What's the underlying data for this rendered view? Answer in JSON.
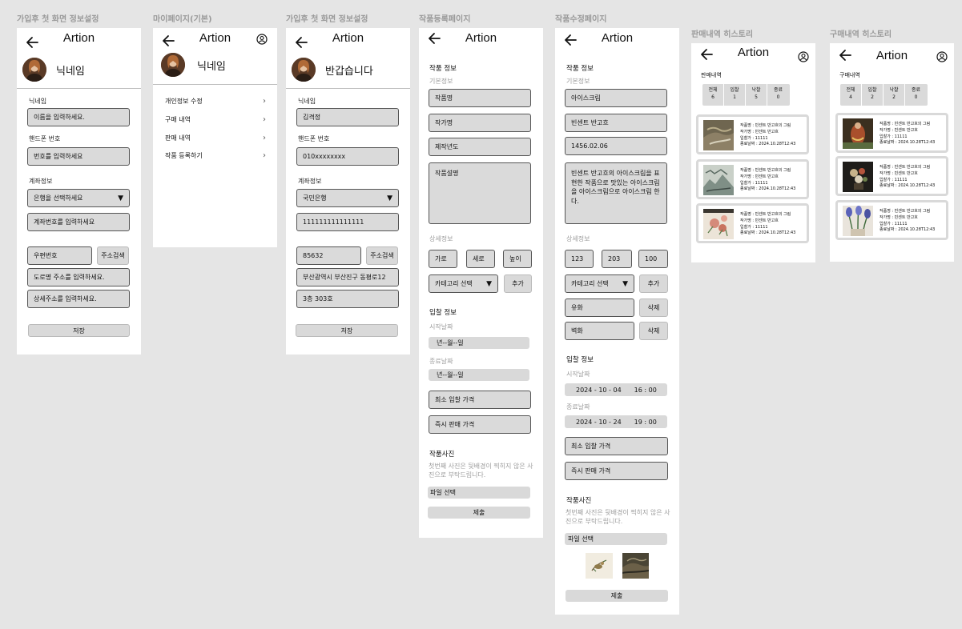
{
  "app_title": "Artion",
  "screens": {
    "signup1": {
      "caption": "가입후 첫 화면 정보설정",
      "nickname": "닉네임",
      "nick_label": "닉네임",
      "nick_placeholder": "이름을 입력하세요.",
      "phone_label": "핸드폰 번호",
      "phone_placeholder": "번호를 입력하세요",
      "account_label": "계좌정보",
      "bank_select": "은행을 선택하세요",
      "account_placeholder": "계좌번호를 입력하세요",
      "zip_placeholder": "우편번호",
      "zip_search": "주소검색",
      "road_placeholder": "도로명 주소를 입력하세요.",
      "detail_placeholder": "상세주소를 입력하세요.",
      "save": "저장"
    },
    "mypage": {
      "caption": "마이페이지(기본)",
      "nickname": "닉네임",
      "menu": [
        "개인정보 수정",
        "구매 내역",
        "판매 내역",
        "작품 등록하기"
      ]
    },
    "signup2": {
      "caption": "가입후 첫 화면 정보설정",
      "greeting": "반갑습니다",
      "nick_label": "닉네임",
      "nick_value": "김격정",
      "phone_label": "핸드폰 번호",
      "phone_value": "010xxxxxxxx",
      "account_label": "계좌정보",
      "bank_value": "국민은행",
      "account_value": "111111111111111",
      "zip_value": "85632",
      "zip_search": "주소검색",
      "road_value": "부산광역시 부산진구 동평로12",
      "detail_value": "3층 303호",
      "save": "저장"
    },
    "register": {
      "caption": "작품등록페이지",
      "info_title": "작품 정보",
      "basic_label": "기본정보",
      "title_ph": "작품명",
      "artist_ph": "작가명",
      "year_ph": "제작년도",
      "desc_ph": "작품설명",
      "detail_label": "상세정보",
      "width_ph": "가로",
      "height_ph": "세로",
      "depth_ph": "높이",
      "category": "카테고리 선택",
      "add": "추가",
      "bid_title": "입찰 정보",
      "start_label": "시작날짜",
      "start_value": "년--월--일",
      "end_label": "종료날짜",
      "end_value": "년--월--일",
      "min_bid": "최소 입찰 가격",
      "buy_now": "즉시 판매 가격",
      "photo_title": "작품사진",
      "photo_note": "첫번째 사진은 뒷배경이 찍히지 않은 사진으로 부탁드립니다.",
      "file_select": "파일 선택",
      "submit": "제출"
    },
    "edit": {
      "caption": "작품수정페이지",
      "info_title": "작품 정보",
      "basic_label": "기본정보",
      "title_value": "아이스크림",
      "artist_value": "빈센트 반고흐",
      "year_value": "1456.02.06",
      "desc_value": "빈센트 반고흐의 아이스크림을 표현한 작품으로 맛있는 아이스크림을 아이스크림으로 아이스크림 한다.",
      "detail_label": "상세정보",
      "width_value": "123",
      "height_value": "203",
      "depth_value": "100",
      "category": "카테고리 선택",
      "add": "추가",
      "tag1": "유화",
      "tag2": "벽화",
      "delete": "삭제",
      "bid_title": "입찰 정보",
      "start_label": "시작날짜",
      "start_date": "2024 - 10 - 04",
      "start_time": "16 : 00",
      "end_label": "종료날짜",
      "end_date": "2024 - 10 - 24",
      "end_time": "19 : 00",
      "min_bid": "최소 입찰 가격",
      "buy_now": "즉시 판매 가격",
      "photo_title": "작품사진",
      "photo_note": "첫번째 사진은 뒷배경이 찍히지 않은 사진으로 부탁드립니다.",
      "file_select": "파일 선택",
      "submit": "제출"
    },
    "sales": {
      "caption": "판매내역 히스토리",
      "subtitle": "판매내역",
      "stats": [
        {
          "label": "전체",
          "count": "6"
        },
        {
          "label": "입찰",
          "count": "1"
        },
        {
          "label": "낙찰",
          "count": "5"
        },
        {
          "label": "종료",
          "count": "0"
        }
      ],
      "items": [
        {
          "name": "작품명 : 빈센트 반고흐의 그림",
          "artist": "작가명 : 빈센트 반고흐",
          "bid": "입찰가 : 11111",
          "end": "종료날짜 : 2024.10.28T12:43"
        },
        {
          "name": "작품명 : 빈센트 반고흐의 그림",
          "artist": "작가명 : 빈센트 반고흐",
          "bid": "입찰가 : 11111",
          "end": "종료날짜 : 2024.10.28T12:43"
        },
        {
          "name": "작품명 : 빈센트 반고흐의 그림",
          "artist": "작가명 : 빈센트 반고흐",
          "bid": "입찰가 : 11111",
          "end": "종료날짜 : 2024.10.28T12:43"
        }
      ]
    },
    "purchases": {
      "caption": "구매내역 히스토리",
      "subtitle": "구매내역",
      "stats": [
        {
          "label": "전체",
          "count": "4"
        },
        {
          "label": "입찰",
          "count": "2"
        },
        {
          "label": "낙찰",
          "count": "2"
        },
        {
          "label": "종료",
          "count": "0"
        }
      ],
      "items": [
        {
          "name": "작품명 : 빈센트 반고흐의 그림",
          "artist": "작가명 : 빈센트 반고흐",
          "bid": "입찰가 : 11111",
          "end": "종료날짜 : 2024.10.28T12:43"
        },
        {
          "name": "작품명 : 빈센트 반고흐의 그림",
          "artist": "작가명 : 빈센트 반고흐",
          "bid": "입찰가 : 11111",
          "end": "종료날짜 : 2024.10.28T12:43"
        },
        {
          "name": "작품명 : 빈센트 반고흐의 그림",
          "artist": "작가명 : 빈센트 반고흐",
          "bid": "입찰가 : 11111",
          "end": "종료날짜 : 2024.10.28T12:43"
        }
      ]
    }
  },
  "icons": {
    "back": "arrow-left-icon",
    "profile": "user-circle-icon",
    "dropdown": "triangle-down-icon",
    "menu": "chevron-right-icon"
  },
  "colors": {
    "canvas": "#e5e5e5",
    "field": "#dadada",
    "caption": "#9a9a9a"
  }
}
